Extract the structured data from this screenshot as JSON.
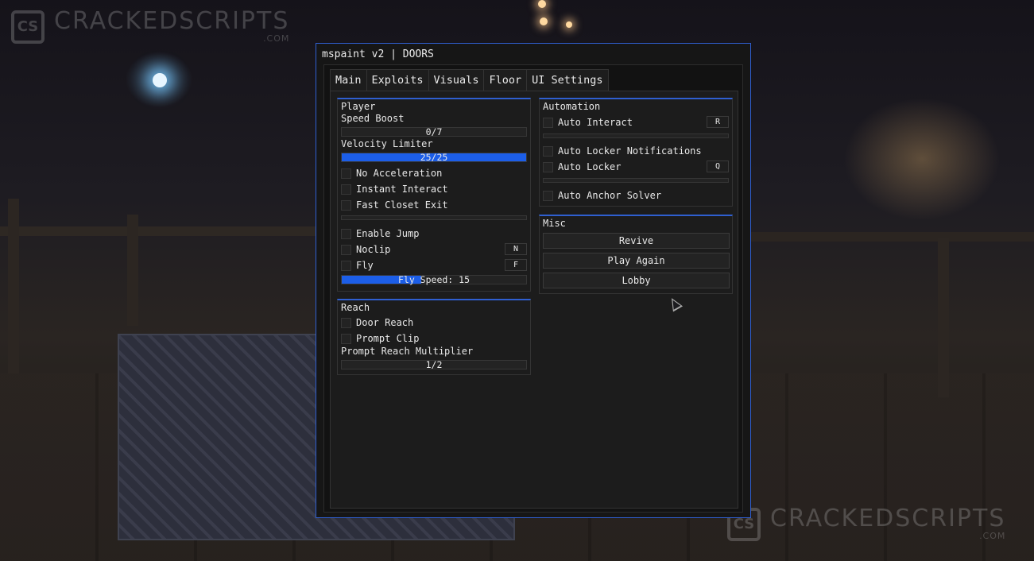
{
  "window": {
    "title": "mspaint v2 | DOORS"
  },
  "tabs": [
    {
      "label": "Main"
    },
    {
      "label": "Exploits"
    },
    {
      "label": "Visuals"
    },
    {
      "label": "Floor"
    },
    {
      "label": "UI Settings"
    }
  ],
  "active_tab": "Main",
  "player": {
    "title": "Player",
    "speed_boost": {
      "label": "Speed Boost",
      "text": "0/7",
      "fill": 0
    },
    "velocity_limiter": {
      "label": "Velocity Limiter",
      "text": "25/25",
      "fill": 1.0
    },
    "no_acceleration": "No Acceleration",
    "instant_interact": "Instant Interact",
    "fast_closet_exit": "Fast Closet Exit",
    "enable_jump": "Enable Jump",
    "noclip": {
      "label": "Noclip",
      "key": "N"
    },
    "fly": {
      "label": "Fly",
      "key": "F"
    },
    "fly_speed": {
      "text": "Fly Speed: 15",
      "fill": 0.43
    }
  },
  "reach": {
    "title": "Reach",
    "door_reach": "Door Reach",
    "prompt_clip": "Prompt Clip",
    "prompt_reach_multiplier": {
      "label": "Prompt Reach Multiplier",
      "text": "1/2",
      "fill": 0
    }
  },
  "automation": {
    "title": "Automation",
    "auto_interact": {
      "label": "Auto Interact",
      "key": "R"
    },
    "auto_locker_notifications": "Auto Locker Notifications",
    "auto_locker": {
      "label": "Auto Locker",
      "key": "Q"
    },
    "auto_anchor_solver": "Auto Anchor Solver"
  },
  "misc": {
    "title": "Misc",
    "revive": "Revive",
    "play_again": "Play Again",
    "lobby": "Lobby"
  },
  "watermark": {
    "text": "CRACKEDSCRIPTS",
    "sub": ".COM",
    "logo": "CS"
  },
  "colors": {
    "accent": "#2f5fd0",
    "slider_fill": "#1c5ee8",
    "panel": "#1c1c1c"
  }
}
